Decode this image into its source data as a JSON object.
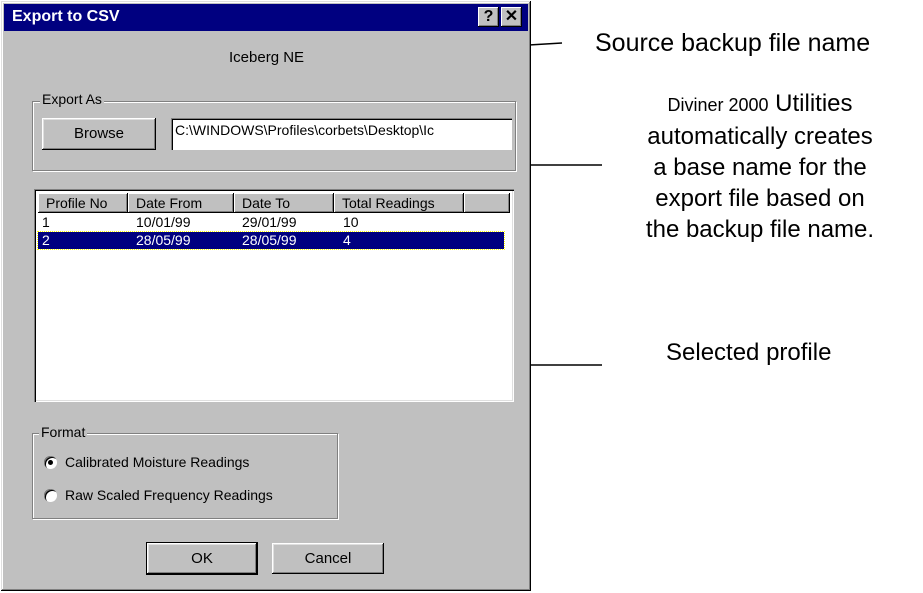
{
  "dialog": {
    "title": "Export to CSV",
    "help_button": "?",
    "close_button": "✕",
    "source_name": "Iceberg NE"
  },
  "export_as": {
    "legend": "Export As",
    "browse_label": "Browse",
    "path_value": "C:\\WINDOWS\\Profiles\\corbets\\Desktop\\Ic"
  },
  "profiles": {
    "columns": [
      "Profile No",
      "Date From",
      "Date To",
      "Total Readings"
    ],
    "rows": [
      {
        "profile": "1",
        "from": "10/01/99",
        "to": "29/01/99",
        "readings": "10",
        "selected": false
      },
      {
        "profile": "2",
        "from": "28/05/99",
        "to": "28/05/99",
        "readings": "4",
        "selected": true
      }
    ]
  },
  "format": {
    "legend": "Format",
    "options": [
      {
        "label": "Calibrated Moisture Readings",
        "checked": true
      },
      {
        "label": "Raw Scaled Frequency Readings",
        "checked": false
      }
    ]
  },
  "buttons": {
    "ok": "OK",
    "cancel": "Cancel"
  },
  "annotations": {
    "source": "Source backup file name",
    "utilities_line1_small": "Diviner 2000",
    "utilities_line1_large": " Utilities",
    "utilities_line2": "automatically creates",
    "utilities_line3": "a base name for the",
    "utilities_line4": "export file based on",
    "utilities_line5": "the backup file name.",
    "selected": "Selected profile"
  },
  "colors": {
    "titlebar": "#000080",
    "face": "#c0c0c0",
    "selection": "#000080"
  }
}
